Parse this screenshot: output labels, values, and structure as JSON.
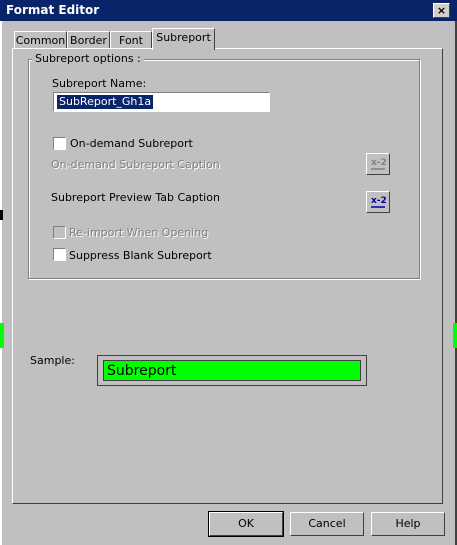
{
  "window": {
    "title": "Format Editor"
  },
  "titlebar": {
    "close_icon": "×"
  },
  "tabs": [
    {
      "label": "Common"
    },
    {
      "label": "Border"
    },
    {
      "label": "Font"
    },
    {
      "label": "Subreport"
    }
  ],
  "options": {
    "group_label": "Subreport options :",
    "name_label": "Subreport Name:",
    "name_value": "SubReport_Gh1a",
    "on_demand_label": "On-demand Subreport",
    "on_demand_caption_label": "On-demand Subreport Caption",
    "preview_tab_caption_label": "Subreport Preview Tab Caption",
    "reimport_label": "Re-import When Opening",
    "suppress_blank_label": "Suppress Blank Subreport",
    "formula_icon_text": "x-2"
  },
  "sample": {
    "label": "Sample:",
    "text": "Subreport"
  },
  "buttons": {
    "ok": "OK",
    "cancel": "Cancel",
    "help": "Help"
  },
  "colors": {
    "titlebar": "#0a246a",
    "sample_bg": "#00ff00",
    "dialog_bg": "#c0c0c0"
  }
}
